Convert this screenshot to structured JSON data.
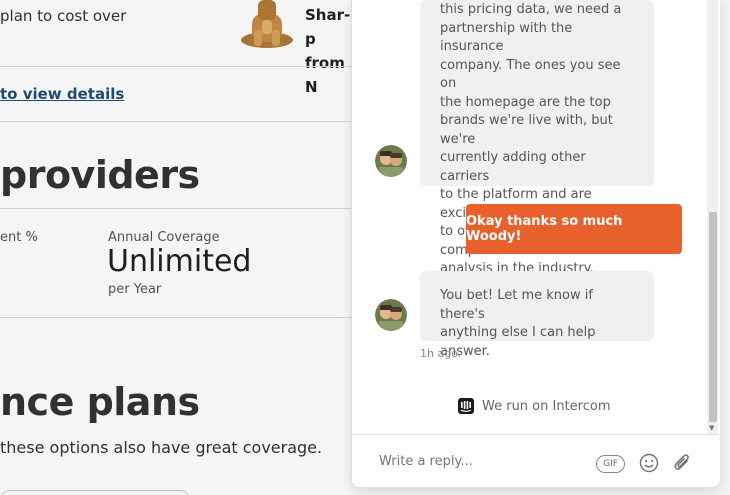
{
  "background_page": {
    "top_text": "plan to cost over",
    "plan_name_line1": "Shar-p",
    "plan_name_line2": "from N",
    "view_details_link": "to view details",
    "providers_heading": "providers",
    "percent_label": "ent %",
    "coverage_label": "Annual Coverage",
    "coverage_value": "Unlimited",
    "coverage_unit": "per Year",
    "plans_heading": "nce plans",
    "plans_subtext": "these options also have great coverage."
  },
  "messenger": {
    "messages": [
      {
        "from": "agent",
        "lines": [
          "this pricing data, we need a",
          "partnership with the insurance",
          "company. The ones you see on",
          "the homepage are the top",
          "brands we're live with, but we're",
          "currently adding other carriers",
          "to the platform and are excited",
          "to offer the most comprehensive",
          "analysis in the industry."
        ]
      },
      {
        "from": "user",
        "text": "Okay thanks so much Woody!"
      },
      {
        "from": "agent",
        "lines": [
          "You bet! Let me know if there's",
          "anything else I can help answer."
        ]
      }
    ],
    "timestamp": "1h ago.",
    "powered_by": "We run on Intercom",
    "composer": {
      "placeholder": "Write a reply...",
      "gif_label": "GIF"
    },
    "colors": {
      "user_bubble": "#e8602c",
      "agent_bubble": "#f0f0f0",
      "link": "#1f4f7a"
    },
    "icons": [
      "intercom-logo-icon",
      "gif-icon",
      "emoji-icon",
      "attachment-icon",
      "agent-avatar"
    ]
  }
}
